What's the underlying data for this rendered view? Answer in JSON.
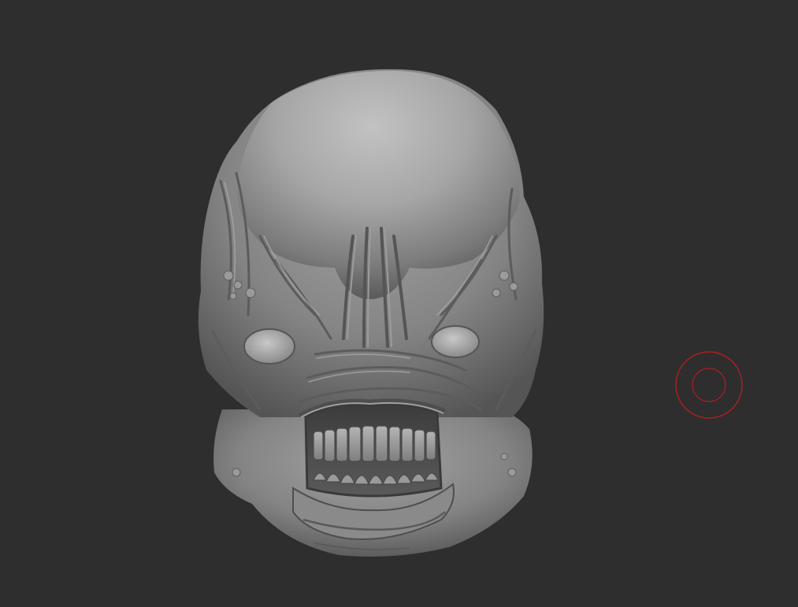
{
  "viewport": {
    "background_color": "#2e2e2e",
    "model_color": "#8a8a8a"
  },
  "brush_cursor": {
    "icon": "brush-circle-icon",
    "color": "#b01e23"
  }
}
